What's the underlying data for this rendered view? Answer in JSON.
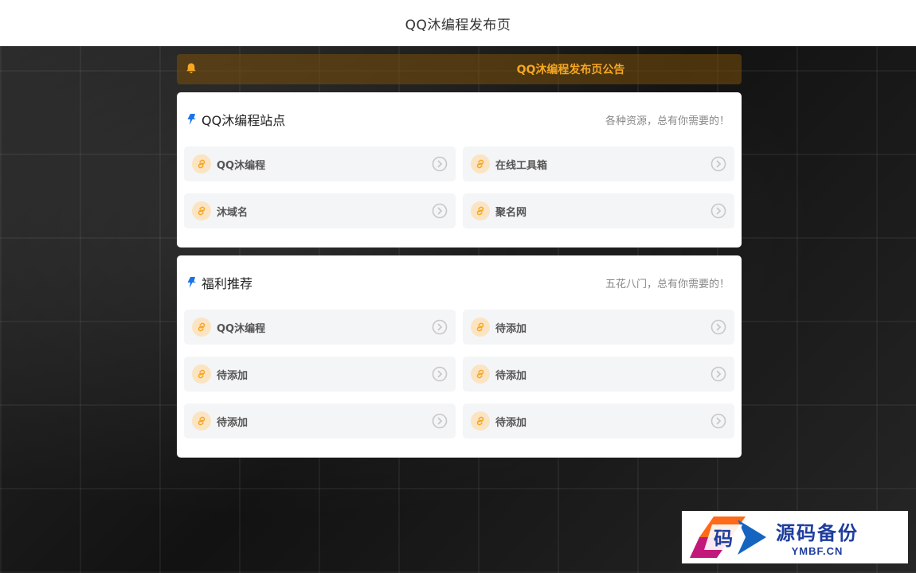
{
  "header": {
    "title": "QQ沐编程发布页"
  },
  "notice": {
    "text": "QQ沐编程发布页公告",
    "icon": "bell-icon",
    "color": "#f5a623"
  },
  "sections": [
    {
      "title": "QQ沐编程站点",
      "subtitle": "各种资源，总有你需要的！",
      "items": [
        {
          "label": "QQ沐编程"
        },
        {
          "label": "在线工具箱"
        },
        {
          "label": "沐域名"
        },
        {
          "label": "聚名网"
        }
      ]
    },
    {
      "title": "福利推荐",
      "subtitle": "五花八门，总有你需要的！",
      "items": [
        {
          "label": "QQ沐编程"
        },
        {
          "label": "待添加"
        },
        {
          "label": "待添加"
        },
        {
          "label": "待添加"
        },
        {
          "label": "待添加"
        },
        {
          "label": "待添加"
        }
      ]
    }
  ],
  "watermark": {
    "logo_char": "码",
    "cn": "源码备份",
    "en": "YMBF.CN"
  },
  "colors": {
    "accent": "#f5a623",
    "pin": "#1a73e8",
    "brand": "#1e3d9e"
  }
}
